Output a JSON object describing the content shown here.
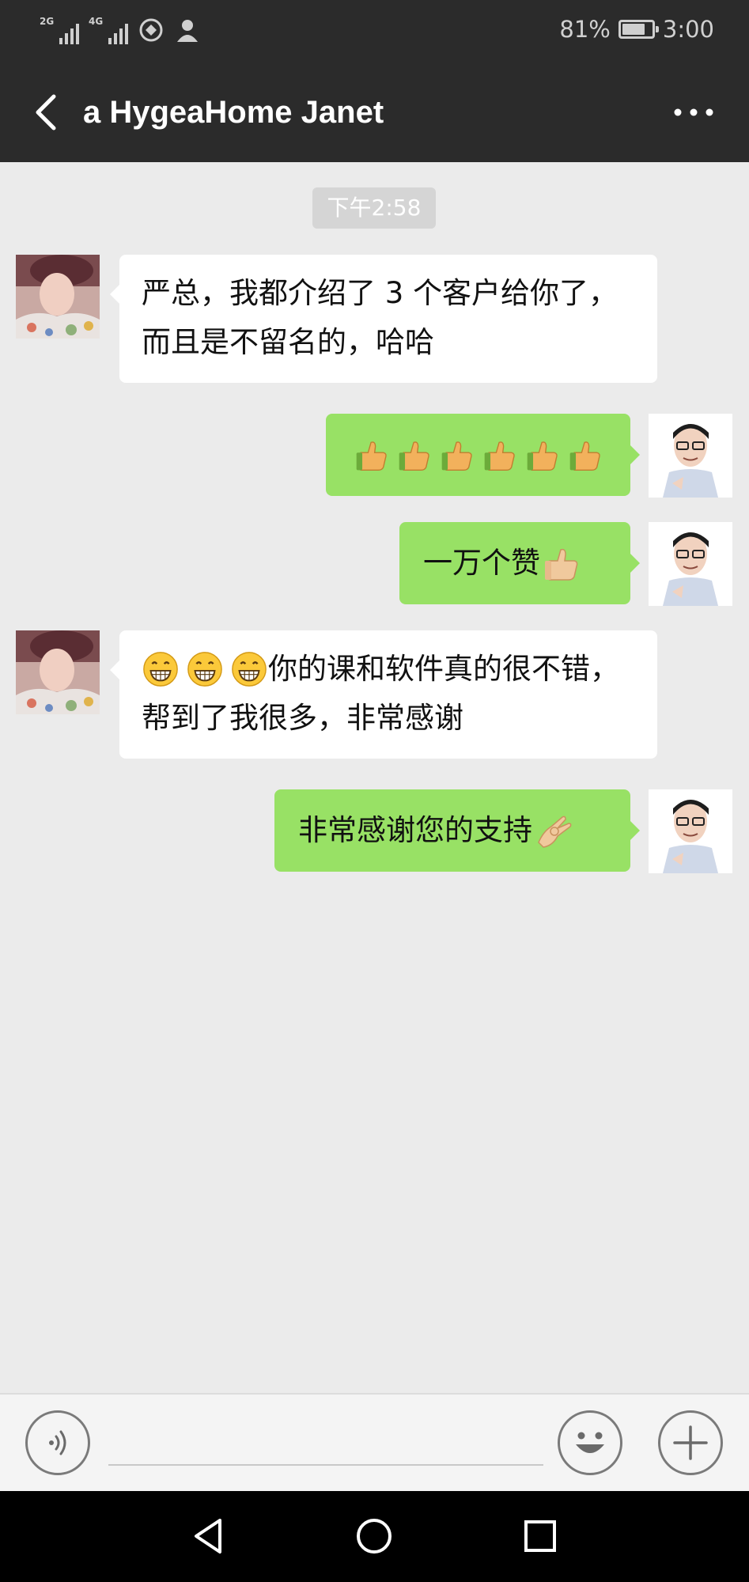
{
  "status_bar": {
    "signal_1": "2G",
    "signal_2": "4G",
    "battery_percent": "81%",
    "battery_level": 0.81,
    "time": "3:00",
    "icons": [
      "signal-2g-icon",
      "signal-4g-icon",
      "vpn-shield-icon",
      "user-icon",
      "battery-icon"
    ]
  },
  "header": {
    "title": "a HygeaHome Janet",
    "back_icon": "chevron-left-icon",
    "more_icon": "more-dots-icon"
  },
  "chat": {
    "timestamp": "下午2:58",
    "messages": [
      {
        "sender": "other",
        "lines": [
          "严总，我都介绍了 3 个客户给你了，",
          "而且是不留名的，哈哈"
        ]
      },
      {
        "sender": "self",
        "emoji": "thumbs-up-icon",
        "emoji_count": 6
      },
      {
        "sender": "self",
        "text": "一万个赞",
        "emoji": "thumbs-up-icon"
      },
      {
        "sender": "other",
        "emoji": "grinning-face-icon",
        "emoji_count": 3,
        "line_1": "你的课和软件真的很不错，",
        "line_2": "帮到了我很多，非常感谢"
      },
      {
        "sender": "self",
        "text": "非常感谢您的支持",
        "emoji": "ok-hand-icon"
      }
    ]
  },
  "input_bar": {
    "voice_icon": "voice-icon",
    "emoji_icon": "emoji-icon",
    "plus_icon": "plus-icon",
    "input_value": ""
  },
  "nav_bar": {
    "icons": [
      "nav-back-icon",
      "nav-home-icon",
      "nav-recents-icon"
    ]
  },
  "colors": {
    "header_bg": "#2b2b2b",
    "chat_bg": "#ebebeb",
    "bubble_self": "#98e165",
    "bubble_other": "#ffffff",
    "timestamp_bg": "#d5d5d5"
  }
}
